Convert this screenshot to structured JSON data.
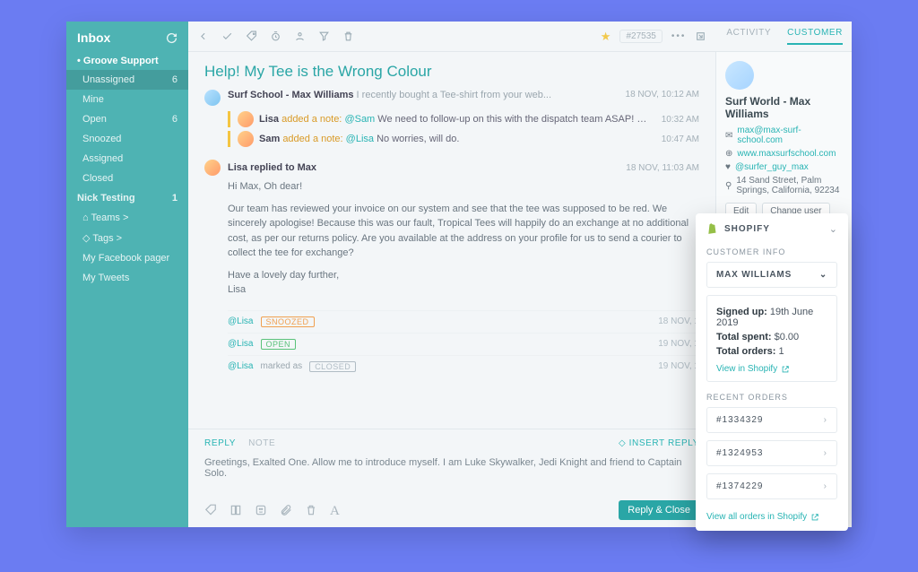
{
  "sidebar": {
    "title": "Inbox",
    "group": "Groove Support",
    "items": [
      {
        "label": "Unassigned",
        "count": "6"
      },
      {
        "label": "Mine",
        "count": ""
      },
      {
        "label": "Open",
        "count": "6"
      },
      {
        "label": "Snoozed",
        "count": ""
      },
      {
        "label": "Assigned",
        "count": ""
      },
      {
        "label": "Closed",
        "count": ""
      }
    ],
    "nick": {
      "label": "Nick Testing",
      "count": "1"
    },
    "extra": [
      {
        "label": "Teams >"
      },
      {
        "label": "Tags >"
      },
      {
        "label": "My Facebook pager"
      },
      {
        "label": "My Tweets"
      }
    ]
  },
  "toolbar": {
    "ticket": "#27535",
    "tabs": {
      "activity": "ACTIVITY",
      "customer": "CUSTOMER"
    }
  },
  "conversation": {
    "subject": "Help! My Tee is the Wrong Colour",
    "first": {
      "author": "Surf School - Max Williams",
      "preview": "I recently bought a Tee-shirt from your web...",
      "time": "18 NOV, 10:12 AM"
    },
    "notes": [
      {
        "author": "Lisa",
        "action": "added a note:",
        "mention": "@Sam",
        "text": "We need to follow-up on this with the dispatch team ASAP! Max Williams is a v...",
        "time": "10:32 AM"
      },
      {
        "author": "Sam",
        "action": "added a note:",
        "mention": "@Lisa",
        "text": "No worries, will do.",
        "time": "10:47 AM"
      }
    ],
    "reply": {
      "header": "Lisa replied to Max",
      "time": "18 NOV, 11:03 AM",
      "body_line1": "Hi Max, Oh dear!",
      "body_para": "Our team has reviewed your invoice on our system and see that the tee was supposed to be red. We sincerely apologise! Because this was our fault, Tropical Tees will happily do an exchange at no additional cost, as per our returns policy. Are you available at the address on your profile for us to send a courier to collect the tee for exchange?",
      "body_closing1": "Have a lovely day further,",
      "body_closing2": "Lisa"
    },
    "statuses": [
      {
        "who": "@Lisa",
        "badge": "SNOOZED",
        "cls": "snoozed",
        "time": "18 NOV, 1"
      },
      {
        "who": "@Lisa",
        "badge": "OPEN",
        "cls": "open",
        "time": "19 NOV, 1"
      },
      {
        "who_prefix": "@Lisa",
        "who_suffix": "marked as",
        "badge": "CLOSED",
        "cls": "closed",
        "time": "19 NOV, 1"
      }
    ]
  },
  "compose": {
    "tabs": {
      "reply": "REPLY",
      "note": "NOTE"
    },
    "insert": "INSERT REPLY",
    "draft": "Greetings, Exalted One. Allow me to introduce myself. I am Luke Skywalker, Jedi Knight and friend to Captain Solo.",
    "send": "Reply & Close"
  },
  "customer": {
    "name": "Surf World - Max Williams",
    "email": "max@max-surf-school.com",
    "website": "www.maxsurfschool.com",
    "twitter": "@surfer_guy_max",
    "address": "14 Sand Street, Palm Springs, California, 92234",
    "actions": {
      "edit": "Edit",
      "change": "Change user"
    }
  },
  "shopify": {
    "brand": "SHOPIFY",
    "section_customer": "CUSTOMER INFO",
    "cust_name": "MAX WILLIAMS",
    "signed_up_label": "Signed up:",
    "signed_up": "19th June 2019",
    "total_spent_label": "Total spent:",
    "total_spent": "$0.00",
    "total_orders_label": "Total orders:",
    "total_orders": "1",
    "view_in": "View in Shopify",
    "section_orders": "RECENT ORDERS",
    "orders": [
      "#1334329",
      "#1324953",
      "#1374229"
    ],
    "view_all": "View all orders in Shopify"
  }
}
